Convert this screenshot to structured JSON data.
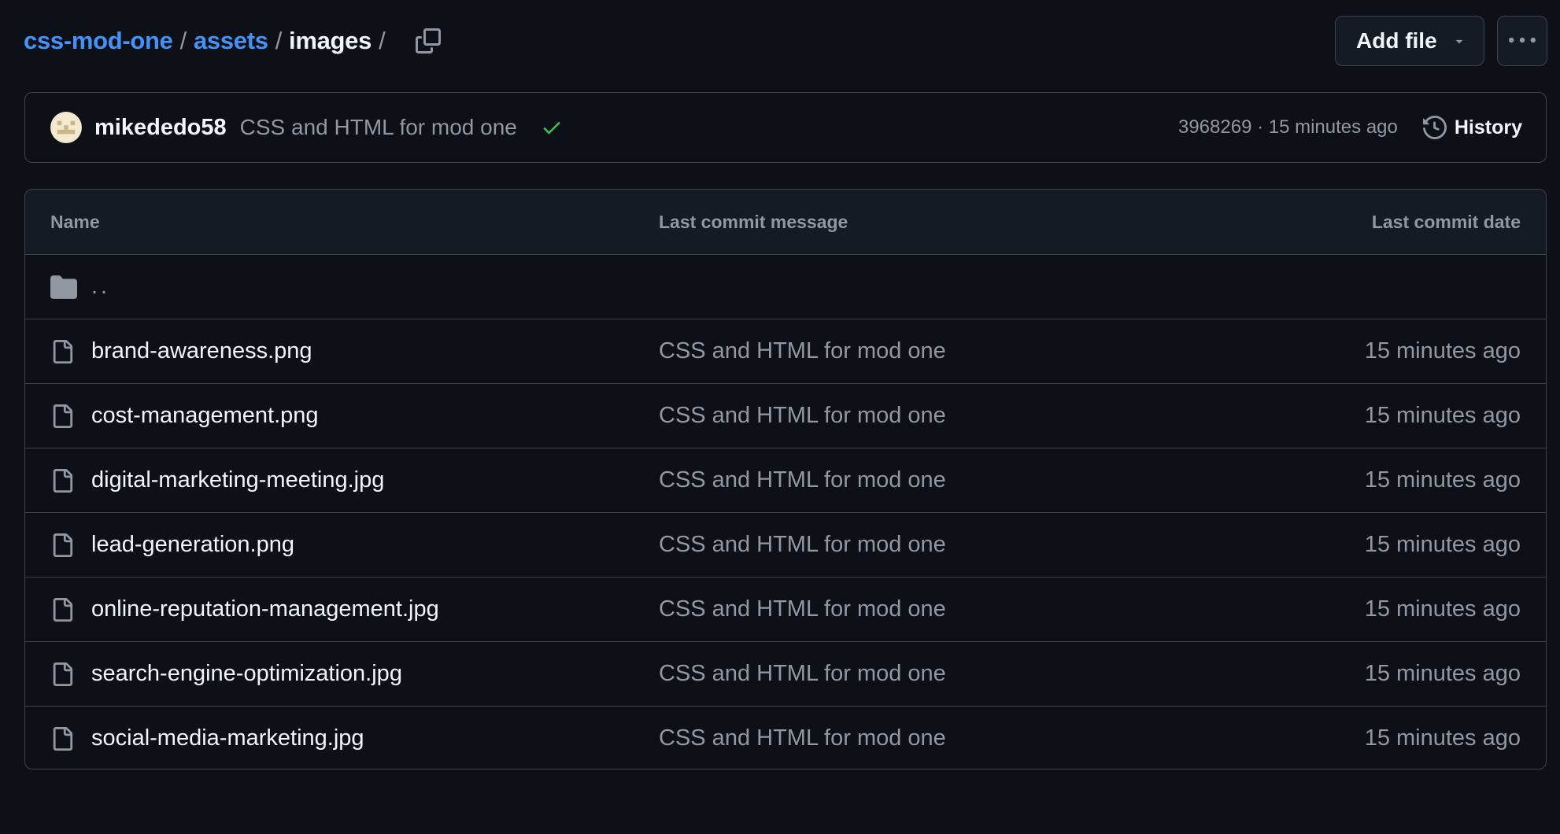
{
  "breadcrumb": {
    "repo": "css-mod-one",
    "folder": "assets",
    "current": "images",
    "separator": "/"
  },
  "toolbar": {
    "add_file_label": "Add file",
    "more_icon": "kebab-horizontal-icon",
    "copy_icon": "copy-icon"
  },
  "commit": {
    "author": "mikededo58",
    "message": "CSS and HTML for mod one",
    "status_icon": "check-icon",
    "meta": "3968269 · 15 minutes ago",
    "history_label": "History"
  },
  "table": {
    "headers": {
      "name": "Name",
      "message": "Last commit message",
      "date": "Last commit date"
    },
    "parent": "..",
    "files": [
      {
        "name": "brand-awareness.png",
        "message": "CSS and HTML for mod one",
        "date": "15 minutes ago"
      },
      {
        "name": "cost-management.png",
        "message": "CSS and HTML for mod one",
        "date": "15 minutes ago"
      },
      {
        "name": "digital-marketing-meeting.jpg",
        "message": "CSS and HTML for mod one",
        "date": "15 minutes ago"
      },
      {
        "name": "lead-generation.png",
        "message": "CSS and HTML for mod one",
        "date": "15 minutes ago"
      },
      {
        "name": "online-reputation-management.jpg",
        "message": "CSS and HTML for mod one",
        "date": "15 minutes ago"
      },
      {
        "name": "search-engine-optimization.jpg",
        "message": "CSS and HTML for mod one",
        "date": "15 minutes ago"
      },
      {
        "name": "social-media-marketing.jpg",
        "message": "CSS and HTML for mod one",
        "date": "15 minutes ago"
      }
    ]
  },
  "colors": {
    "background": "#0d1117",
    "link": "#4493f8",
    "success": "#3fb950",
    "muted": "#9198a1",
    "border": "#3d444d"
  }
}
